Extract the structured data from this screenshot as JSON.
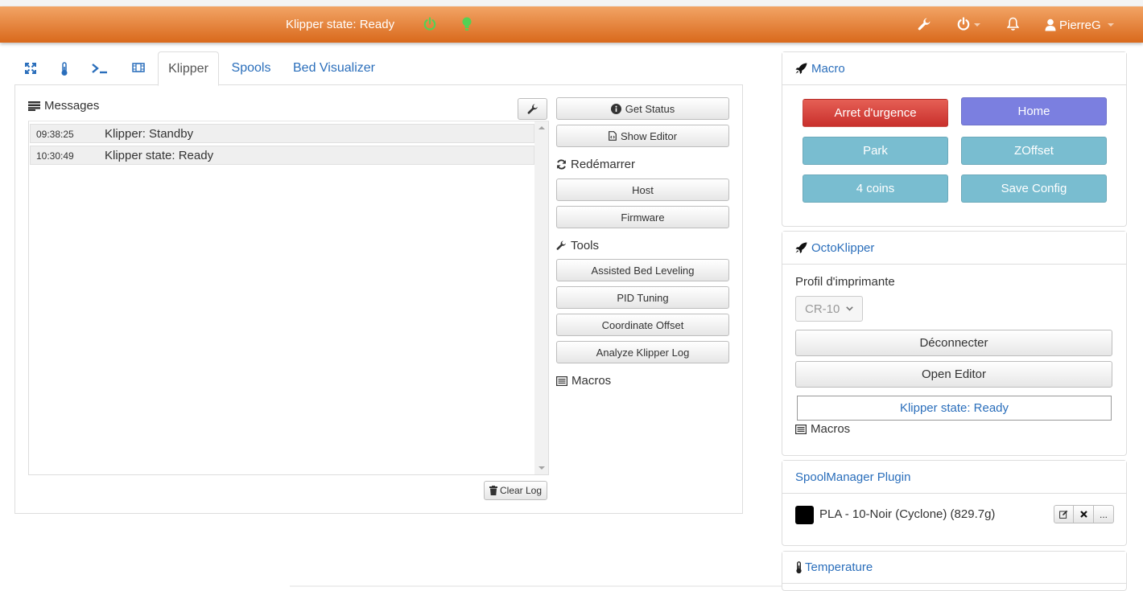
{
  "navbar": {
    "status_text": "Klipper state: Ready",
    "user_name": "PierreG",
    "power_icon_color": "#54d154",
    "bulb_icon_color": "#54d154"
  },
  "tabs": {
    "items": [
      {
        "label": "Klipper"
      },
      {
        "label": "Spools"
      },
      {
        "label": "Bed Visualizer"
      }
    ]
  },
  "messages": {
    "title": "Messages",
    "rows": [
      {
        "time": "09:38:25",
        "text": "Klipper: Standby"
      },
      {
        "time": "10:30:49",
        "text": "Klipper state: Ready"
      }
    ],
    "clear_label": "Clear Log"
  },
  "controls": {
    "get_status": "Get Status",
    "show_editor": "Show Editor",
    "restart_label": "Redémarrer",
    "host": "Host",
    "firmware": "Firmware",
    "tools_label": "Tools",
    "assisted_bed_leveling": "Assisted Bed Leveling",
    "pid_tuning": "PID Tuning",
    "coordinate_offset": "Coordinate Offset",
    "analyze_log": "Analyze Klipper Log",
    "macros_label": "Macros"
  },
  "macro_panel": {
    "title": "Macro",
    "buttons": [
      {
        "label": "Arret d'urgence",
        "color": "#d9534f"
      },
      {
        "label": "Home",
        "color": "#7b7fe0"
      },
      {
        "label": "Park",
        "color": "#79bdd0"
      },
      {
        "label": "ZOffset",
        "color": "#79bdd0"
      },
      {
        "label": "4 coins",
        "color": "#79bdd0"
      },
      {
        "label": "Save Config",
        "color": "#79bdd0"
      }
    ]
  },
  "octoklipper": {
    "title": "OctoKlipper",
    "profile_label": "Profil d'imprimante",
    "profile_value": "CR-10",
    "disconnect": "Déconnecter",
    "open_editor": "Open Editor",
    "state": "Klipper state: Ready",
    "macros_label": "Macros"
  },
  "spoolmanager": {
    "title": "SpoolManager Plugin",
    "spool_text": "PLA - 10-Noir (Cyclone) (829.7g)",
    "spool_color": "#000000",
    "more_label": "..."
  },
  "temperature": {
    "title": "Temperature"
  }
}
